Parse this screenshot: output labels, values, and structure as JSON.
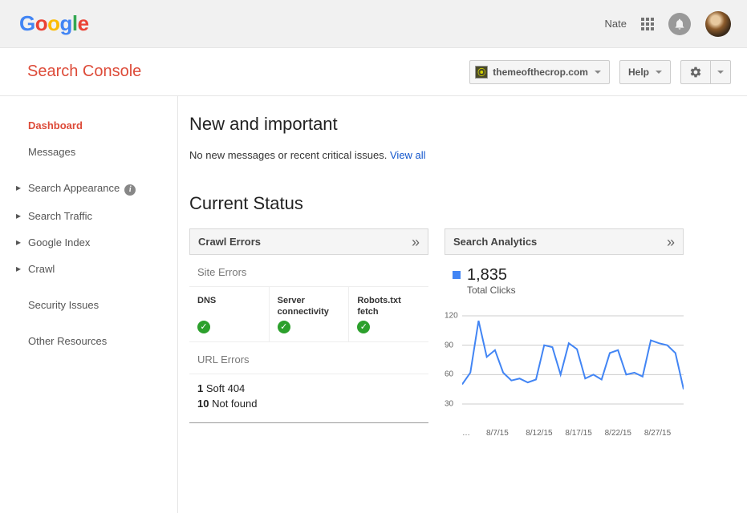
{
  "topbar": {
    "user_name": "Nate"
  },
  "subhead": {
    "product_name": "Search Console",
    "property": "themeofthecrop.com",
    "help_label": "Help"
  },
  "sidebar": {
    "items": [
      {
        "label": "Dashboard",
        "active": true
      },
      {
        "label": "Messages"
      },
      {
        "label": "Search Appearance",
        "parent": true,
        "info": true
      },
      {
        "label": "Search Traffic",
        "parent": true
      },
      {
        "label": "Google Index",
        "parent": true
      },
      {
        "label": "Crawl",
        "parent": true
      },
      {
        "label": "Security Issues"
      },
      {
        "label": "Other Resources"
      }
    ]
  },
  "main": {
    "new_heading": "New and important",
    "no_messages": "No new messages or recent critical issues.",
    "view_all": "View all",
    "status_heading": "Current Status"
  },
  "crawl_panel": {
    "title": "Crawl Errors",
    "site_errors_label": "Site Errors",
    "cols": {
      "dns": "DNS",
      "conn": "Server connectivity",
      "robots": "Robots.txt fetch"
    },
    "url_errors_label": "URL Errors",
    "errors": [
      {
        "count": "1",
        "label": "Soft 404"
      },
      {
        "count": "10",
        "label": "Not found"
      }
    ]
  },
  "analytics_panel": {
    "title": "Search Analytics",
    "metric_value": "1,835",
    "metric_label": "Total Clicks"
  },
  "chart_data": {
    "type": "line",
    "title": "",
    "ylabel": "",
    "xlabel": "",
    "ylim": [
      30,
      120
    ],
    "yticks": [
      30,
      60,
      90,
      120
    ],
    "xticks": [
      "…",
      "8/7/15",
      "8/12/15",
      "8/17/15",
      "8/22/15",
      "8/27/15"
    ],
    "x": [
      0,
      1,
      2,
      3,
      4,
      5,
      6,
      7,
      8,
      9,
      10,
      11,
      12,
      13,
      14,
      15,
      16,
      17,
      18,
      19,
      20,
      21,
      22,
      23,
      24,
      25,
      26,
      27
    ],
    "values": [
      50,
      62,
      115,
      78,
      85,
      62,
      54,
      56,
      52,
      55,
      90,
      88,
      60,
      92,
      86,
      56,
      60,
      55,
      82,
      85,
      60,
      62,
      58,
      95,
      92,
      90,
      82,
      45
    ]
  }
}
